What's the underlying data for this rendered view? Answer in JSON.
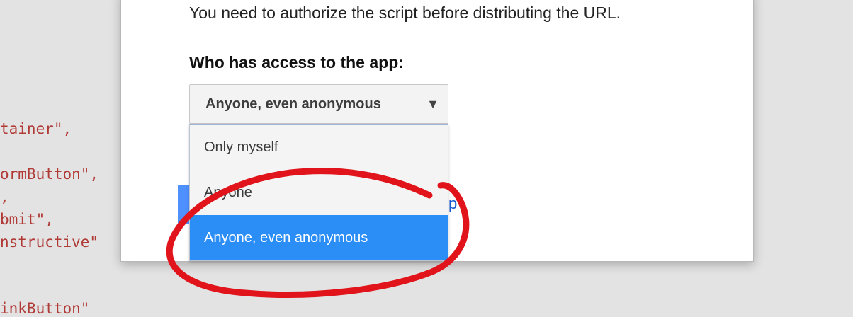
{
  "background_code": {
    "lines": [
      "tainer\",",
      "ormButton\",",
      ",",
      "bmit\",",
      "nstructive\"",
      "inkButton\""
    ]
  },
  "dialog": {
    "info_text": "You need to authorize the script before distributing the URL.",
    "access_label": "Who has access to the app:",
    "access_select": {
      "selected_value": "Anyone, even anonymous",
      "caret": "▼",
      "options": [
        "Only myself",
        "Anyone",
        "Anyone, even anonymous"
      ],
      "highlighted_index": 2
    },
    "help_link_partial": "p"
  },
  "colors": {
    "highlight": "#2b8ef6",
    "annotation_red": "#e0141a",
    "code_text": "#b03a36"
  }
}
